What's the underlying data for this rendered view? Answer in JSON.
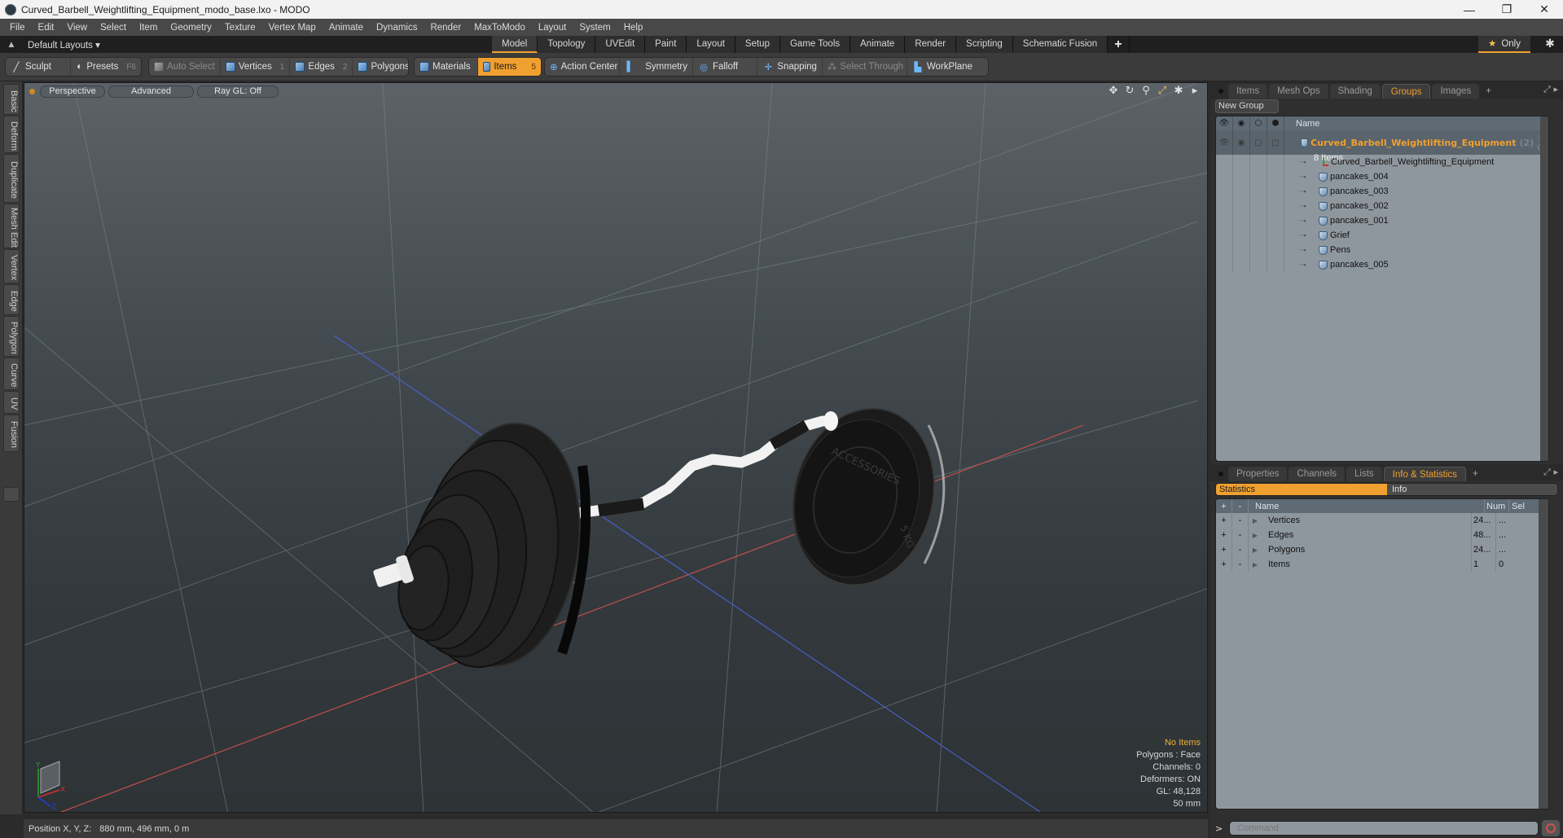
{
  "window": {
    "title": "Curved_Barbell_Weightlifting_Equipment_modo_base.lxo - MODO",
    "controls": {
      "minimize": "—",
      "restore": "❐",
      "close": "✕"
    }
  },
  "menu": [
    "File",
    "Edit",
    "View",
    "Select",
    "Item",
    "Geometry",
    "Texture",
    "Vertex Map",
    "Animate",
    "Dynamics",
    "Render",
    "MaxToModo",
    "Layout",
    "System",
    "Help"
  ],
  "layouts": {
    "selector": "Default Layouts ▾",
    "tabs": [
      "Model",
      "Topology",
      "UVEdit",
      "Paint",
      "Layout",
      "Setup",
      "Game Tools",
      "Animate",
      "Render",
      "Scripting",
      "Schematic Fusion"
    ],
    "active_tab": "Model",
    "add_tab": "+",
    "only_label": "Only",
    "star": "★",
    "gear": "✱"
  },
  "toolbar": {
    "sculpt": "Sculpt",
    "presets": "Presets",
    "presets_key": "F6",
    "auto_select": "Auto Select",
    "vertices": "Vertices",
    "vertices_key": "1",
    "edges": "Edges",
    "edges_key": "2",
    "polygons": "Polygons",
    "materials": "Materials",
    "items": "Items",
    "items_key": "5",
    "action_center": "Action Center",
    "symmetry": "Symmetry",
    "falloff": "Falloff",
    "snapping": "Snapping",
    "select_through": "Select Through",
    "workplane": "WorkPlane"
  },
  "left_tabs": [
    "Basic",
    "Deform",
    "Duplicate",
    "Mesh Edit",
    "Vertex",
    "Edge",
    "Polygon",
    "Curve",
    "UV",
    "Fusion"
  ],
  "viewport": {
    "view_mode": "Perspective",
    "shading": "Advanced",
    "raygl": "Ray GL: Off",
    "icons": [
      "move-icon",
      "rotate-icon",
      "zoom-icon",
      "maximize-icon",
      "settings-icon",
      "more-icon"
    ],
    "overlay": {
      "selection": "No Items",
      "polygons": "Polygons : Face",
      "channels": "Channels: 0",
      "deformers": "Deformers: ON",
      "gl": "GL: 48,128",
      "grid": "50 mm"
    },
    "axis_labels": {
      "x": "X",
      "y": "Y",
      "z": "Z"
    },
    "plate_text": "ACCESSORIES",
    "plate_weight": "5 KG"
  },
  "status": {
    "label": "Position X, Y, Z:",
    "value": "880 mm, 496 mm, 0 m"
  },
  "groups_panel": {
    "tabs": [
      "Items",
      "Mesh Ops",
      "Shading",
      "Groups",
      "Images"
    ],
    "active_tab": "Groups",
    "new_group": "New Group",
    "column_name": "Name",
    "group": {
      "name": "Curved_Barbell_Weightlifting_Equipment",
      "count": "(2)",
      "suffix": ": G...",
      "items_label": "8 Items"
    },
    "items": [
      {
        "name": "Curved_Barbell_Weightlifting_Equipment",
        "type": "locator"
      },
      {
        "name": "pancakes_004",
        "type": "mesh"
      },
      {
        "name": "pancakes_003",
        "type": "mesh"
      },
      {
        "name": "pancakes_002",
        "type": "mesh"
      },
      {
        "name": "pancakes_001",
        "type": "mesh"
      },
      {
        "name": "Grief",
        "type": "mesh"
      },
      {
        "name": "Pens",
        "type": "mesh"
      },
      {
        "name": "pancakes_005",
        "type": "mesh"
      }
    ]
  },
  "info_panel": {
    "tabs": [
      "Properties",
      "Channels",
      "Lists",
      "Info & Statistics"
    ],
    "active_tab": "Info & Statistics",
    "subtabs": [
      "Statistics",
      "Info"
    ],
    "columns": {
      "plus": "+",
      "minus": "-",
      "name": "Name",
      "num": "Num",
      "sel": "Sel"
    },
    "rows": [
      {
        "name": "Vertices",
        "num": "24...",
        "sel": "..."
      },
      {
        "name": "Edges",
        "num": "48...",
        "sel": "..."
      },
      {
        "name": "Polygons",
        "num": "24...",
        "sel": "..."
      },
      {
        "name": "Items",
        "num": "1",
        "sel": "0"
      }
    ]
  },
  "command": {
    "prompt": ">",
    "placeholder": "Command"
  }
}
